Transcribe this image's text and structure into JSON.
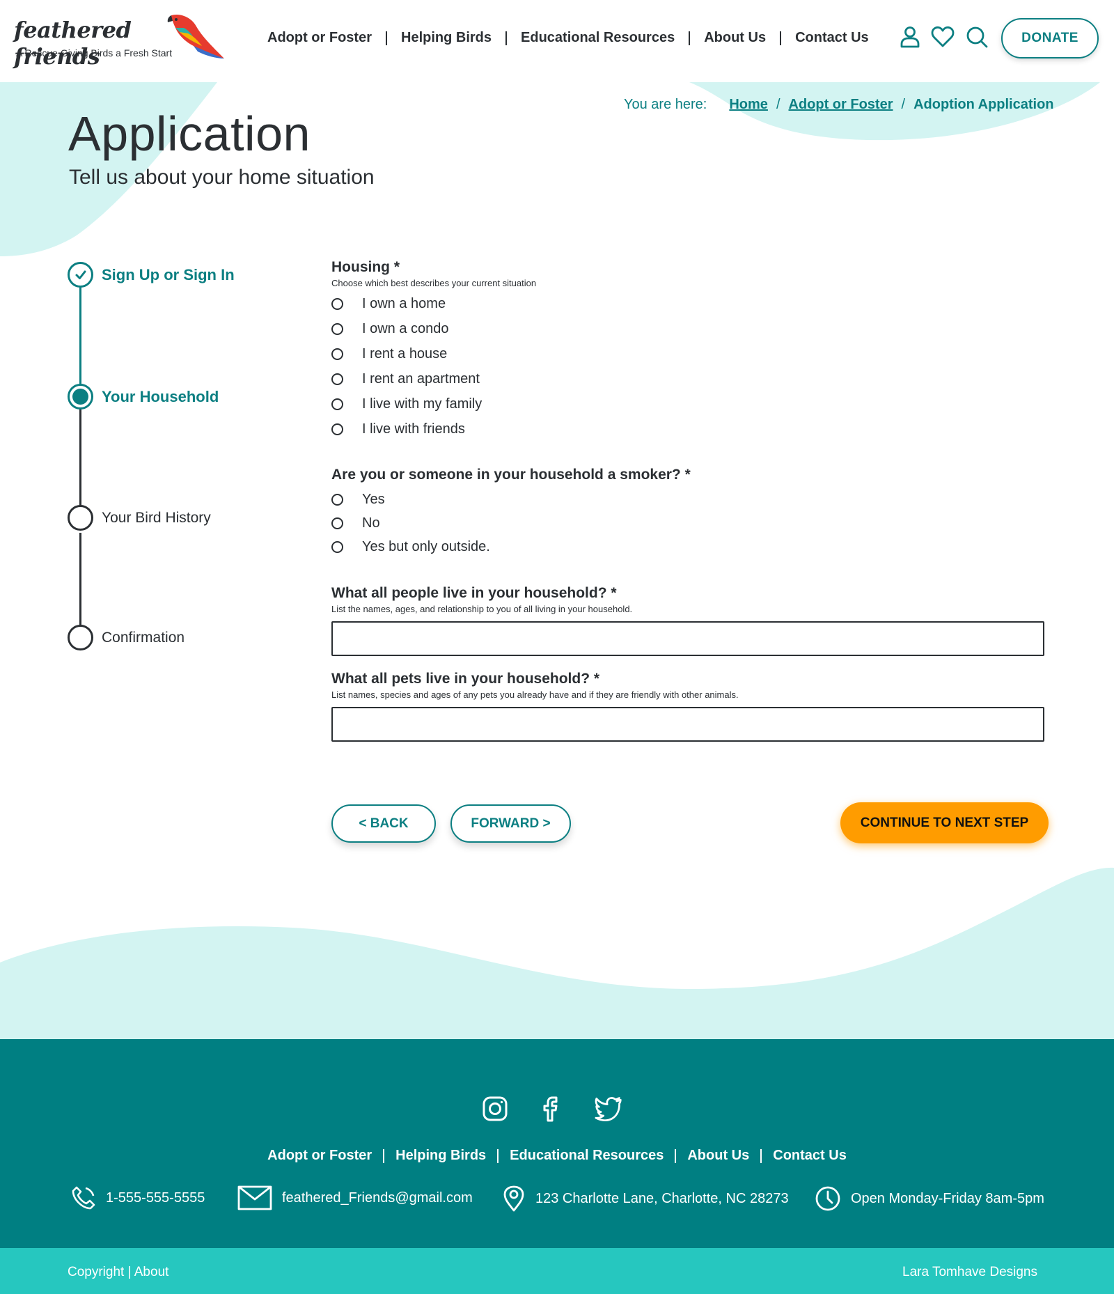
{
  "brand": {
    "name": "feathered friends",
    "tagline": "A Rescue Giving Birds a Fresh Start"
  },
  "nav": {
    "items": [
      "Adopt or Foster",
      "Helping Birds",
      "Educational Resources",
      "About Us",
      "Contact Us"
    ]
  },
  "header_icons": [
    "user-icon",
    "heart-icon",
    "search-icon"
  ],
  "donate_label": "DONATE",
  "breadcrumb": {
    "label": "You are here:",
    "links": [
      "Home",
      "Adopt or Foster"
    ],
    "current": "Adoption Application"
  },
  "page": {
    "title": "Application",
    "subtitle": "Tell us about your home situation"
  },
  "steps": [
    {
      "label": "Sign Up or Sign In",
      "state": "completed"
    },
    {
      "label": "Your Household",
      "state": "current"
    },
    {
      "label": "Your Bird History",
      "state": "upcoming"
    },
    {
      "label": "Confirmation",
      "state": "upcoming"
    }
  ],
  "form": {
    "housing": {
      "title": "Housing *",
      "help": "Choose which best describes your current situation",
      "options": [
        "I own a home",
        "I own a condo",
        "I rent a house",
        "I rent an apartment",
        "I live with my family",
        "I live with friends"
      ],
      "selected": null
    },
    "smoker": {
      "title": "Are you or someone in your household a smoker? *",
      "options": [
        "Yes",
        "No",
        "Yes but only outside."
      ],
      "selected": null
    },
    "people": {
      "title": "What all people live in your household? *",
      "help": "List the names, ages, and relationship to you of all  living in your household.",
      "value": ""
    },
    "pets": {
      "title": "What all pets live in your household? *",
      "help": "List names, species and ages of any pets you already have and if they are friendly with other animals.",
      "value": ""
    }
  },
  "buttons": {
    "back": "< BACK",
    "forward": "FORWARD >",
    "continue": "CONTINUE TO NEXT STEP"
  },
  "footer": {
    "social": [
      "instagram-icon",
      "facebook-icon",
      "twitter-icon"
    ],
    "nav": [
      "Adopt or Foster",
      "Helping Birds",
      "Educational Resources",
      "About Us",
      "Contact Us"
    ],
    "phone": "1-555-555-5555",
    "email": "feathered_Friends@gmail.com",
    "address": "123 Charlotte Lane, Charlotte, NC 28273",
    "hours": "Open Monday-Friday 8am-5pm",
    "copyright": "Copyright | About",
    "credit": "Lara Tomhave Designs"
  },
  "colors": {
    "teal": "#0c7f82",
    "light_teal": "#d3f4f2",
    "footer_teal": "#007f82",
    "subfooter_teal": "#26c7bf",
    "orange": "#ff9c00",
    "text": "#2b2f33"
  }
}
